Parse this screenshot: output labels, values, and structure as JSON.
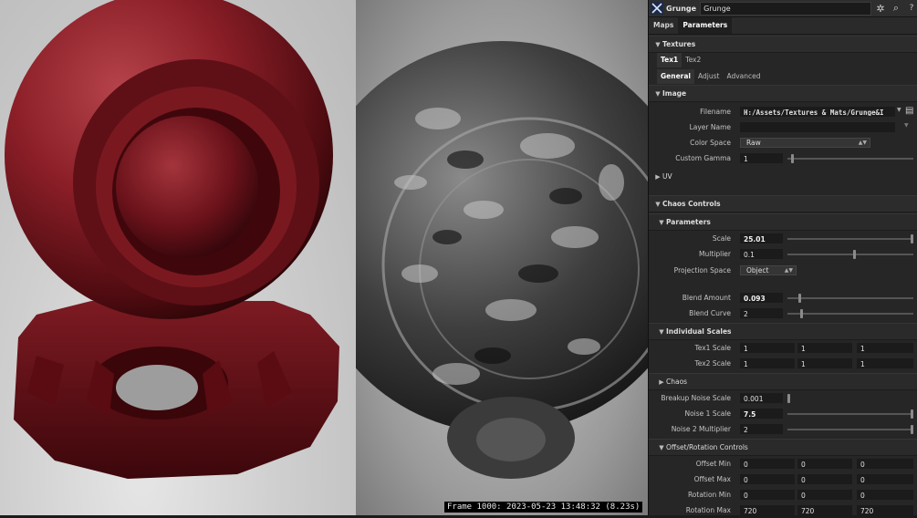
{
  "viewport": {
    "frame_info": "Frame 1000: 2023-05-23 13:48:32 (8.23s)"
  },
  "panel": {
    "node_type": "Grunge",
    "node_name": "Grunge",
    "tabs": [
      "Maps",
      "Parameters"
    ],
    "textures_header": "Textures",
    "tex_tabs": [
      "Tex1",
      "Tex2"
    ],
    "sub_tabs": [
      "General",
      "Adjust",
      "Advanced"
    ],
    "image_header": "Image",
    "filename_label": "Filename",
    "filename_value": "H:/Assets/Textures & Mats/Grunge&I",
    "layer_name_label": "Layer Name",
    "layer_name_value": "",
    "color_space_label": "Color Space",
    "color_space_value": "Raw",
    "custom_gamma_label": "Custom Gamma",
    "custom_gamma_value": "1",
    "uv_header": "UV",
    "chaos_controls_header": "Chaos Controls",
    "parameters_header": "Parameters",
    "scale_label": "Scale",
    "scale_value": "25.01",
    "scale_slider": 1.0,
    "multiplier_label": "Multiplier",
    "multiplier_value": "0.1",
    "multiplier_slider": 0.53,
    "projection_label": "Projection Space",
    "projection_value": "Object",
    "blend_amount_label": "Blend Amount",
    "blend_amount_value": "0.093",
    "blend_amount_slider": 0.09,
    "blend_curve_label": "Blend Curve",
    "blend_curve_value": "2",
    "blend_curve_slider": 0.1,
    "individual_scales_header": "Individual Scales",
    "tex1_scale_label": "Tex1 Scale",
    "tex1_scale": [
      "1",
      "1",
      "1"
    ],
    "tex2_scale_label": "Tex2 Scale",
    "tex2_scale": [
      "1",
      "1",
      "1"
    ],
    "chaos_header": "Chaos",
    "breakup_label": "Breakup Noise Scale",
    "breakup_value": "0.001",
    "breakup_slider": 0.0,
    "noise1_label": "Noise 1 Scale",
    "noise1_value": "7.5",
    "noise1_slider": 1.0,
    "noise2_label": "Noise 2 Multiplier",
    "noise2_value": "2",
    "noise2_slider": 1.0,
    "offset_rotation_header": "Offset/Rotation Controls",
    "offset_min_label": "Offset Min",
    "offset_min": [
      "0",
      "0",
      "0"
    ],
    "offset_max_label": "Offset Max",
    "offset_max": [
      "0",
      "0",
      "0"
    ],
    "rotation_min_label": "Rotation Min",
    "rotation_min": [
      "0",
      "0",
      "0"
    ],
    "rotation_max_label": "Rotation Max",
    "rotation_max": [
      "720",
      "720",
      "720"
    ]
  }
}
